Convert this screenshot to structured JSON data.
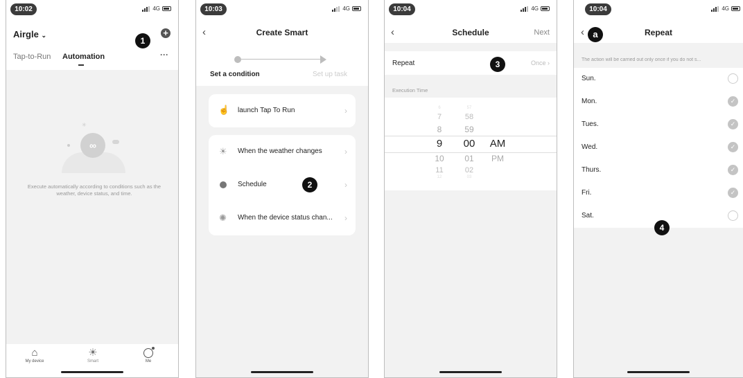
{
  "screen1": {
    "time": "10:02",
    "network": "4G",
    "home_name": "Airgle",
    "tabs": [
      "Tap-to-Run",
      "Automation"
    ],
    "more": "···",
    "empty_text": "Execute automatically according to conditions such as the weather, device status, and time.",
    "nav": [
      {
        "label": "My device",
        "icon": "home-icon"
      },
      {
        "label": "Smart",
        "icon": "sun-icon"
      },
      {
        "label": "Me",
        "icon": "user-icon"
      }
    ],
    "badge": "1"
  },
  "screen2": {
    "time": "10:03",
    "network": "4G",
    "title": "Create Smart",
    "step1": "Set a condition",
    "step2": "Set up task",
    "items": [
      {
        "label": "launch Tap To Run",
        "icon": "hand-tap-icon"
      },
      {
        "label": "When the weather changes",
        "icon": "sun-icon"
      },
      {
        "label": "Schedule",
        "icon": "clock-icon"
      },
      {
        "label": "When the device status chan...",
        "icon": "device-status-icon"
      }
    ],
    "badge": "2"
  },
  "screen3": {
    "time": "10:04",
    "network": "4G",
    "title": "Schedule",
    "next": "Next",
    "repeat_label": "Repeat",
    "repeat_value": "Once",
    "section": "Execution Time",
    "hours": [
      "6",
      "7",
      "8",
      "9",
      "10",
      "11",
      "12"
    ],
    "minutes": [
      "57",
      "58",
      "59",
      "00",
      "01",
      "02",
      "03"
    ],
    "ampm": [
      "AM",
      "PM"
    ],
    "badge": "3"
  },
  "screen4": {
    "time": "10:04",
    "network": "4G",
    "title": "Repeat",
    "note": "The action will be carried out only once if you do not s...",
    "days": [
      {
        "label": "Sun.",
        "checked": false
      },
      {
        "label": "Mon.",
        "checked": true
      },
      {
        "label": "Tues.",
        "checked": true
      },
      {
        "label": "Wed.",
        "checked": true
      },
      {
        "label": "Thurs.",
        "checked": true
      },
      {
        "label": "Fri.",
        "checked": true
      },
      {
        "label": "Sat.",
        "checked": false
      }
    ],
    "badge_a": "a",
    "badge": "4"
  }
}
